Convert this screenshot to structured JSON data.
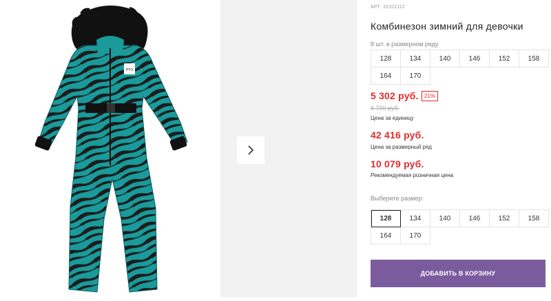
{
  "product": {
    "article_label": "АРТ.",
    "article_number": "32321112",
    "title": "Комбинезон зимний для девочки",
    "image_logo_text": "PTO"
  },
  "size_range": {
    "label": "8 шт. в размерном ряду",
    "sizes": [
      "128",
      "134",
      "140",
      "146",
      "152",
      "158",
      "164",
      "170"
    ]
  },
  "pricing": {
    "unit_price": "5 302 руб.",
    "discount": "21%",
    "old_price": "6 700 руб.",
    "unit_price_label": "Цена за единицу",
    "range_price": "42 416 руб.",
    "range_price_label": "Цена за размерный ряд",
    "retail_price": "10 079 руб.",
    "retail_price_label": "Рекомендуемая розничная цена"
  },
  "size_select": {
    "label": "Выберите размер:",
    "sizes": [
      "128",
      "134",
      "140",
      "146",
      "152",
      "158",
      "164",
      "170"
    ],
    "selected": "128"
  },
  "cart": {
    "button_label": "ДОБАВИТЬ В КОРЗИНУ"
  },
  "colors": {
    "accent": "#7a5b9e",
    "price_red": "#e32b2b",
    "teal": "#1a9a9a",
    "stripe": "#1c1c1c"
  }
}
